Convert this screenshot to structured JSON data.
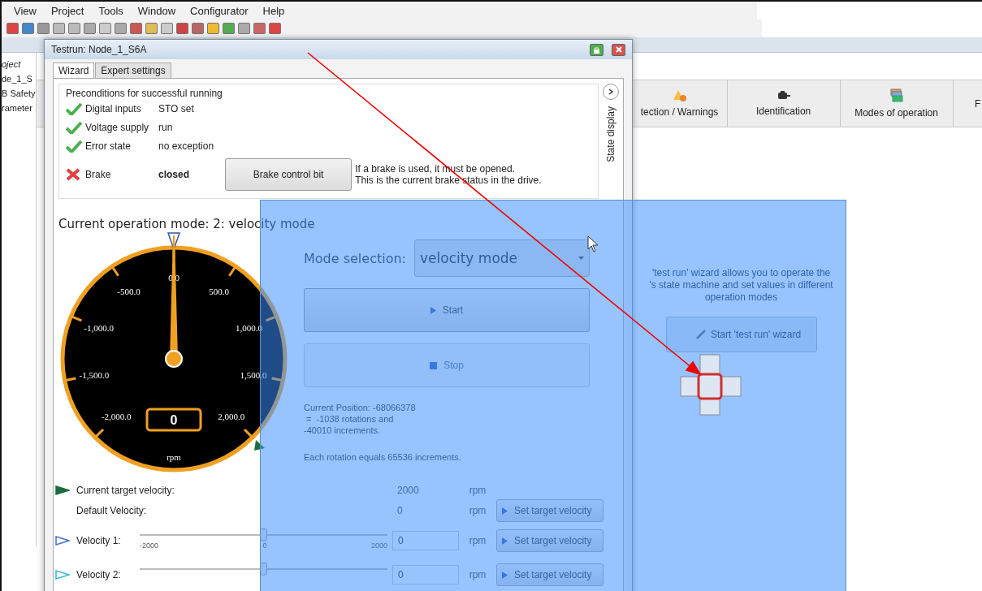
{
  "menu": [
    "View",
    "Project",
    "Tools",
    "Window",
    "Configurator",
    "Help"
  ],
  "project_panel": {
    "title": "oject",
    "items": [
      "de_1_S",
      "B Safety",
      "rameter"
    ]
  },
  "ribbon": [
    {
      "label": "tection / Warnings",
      "kind": "warning"
    },
    {
      "label": "Identification",
      "kind": "motor"
    },
    {
      "label": "Modes of operation",
      "kind": "modes"
    },
    {
      "label": "F",
      "kind": "plain"
    }
  ],
  "start_panel": {
    "lines": [
      "'test run' wizard allows you to operate the",
      "'s state machine and set values in different",
      "operation modes"
    ],
    "button": "Start 'test run' wizard"
  },
  "dialog": {
    "title": "Testrun: Node_1_S6A",
    "tabs": [
      {
        "label": "Wizard",
        "selected": true
      },
      {
        "label": "Expert settings",
        "selected": false
      }
    ],
    "preconditions": {
      "title": "Preconditions for successful running",
      "rows": [
        {
          "label": "Digital inputs",
          "value": "STO set",
          "ok": true
        },
        {
          "label": "Voltage supply",
          "value": "run",
          "ok": true
        },
        {
          "label": "Error state",
          "value": "no exception",
          "ok": true
        },
        {
          "label": "Brake",
          "value": "closed",
          "ok": false
        }
      ],
      "brake_button": "Brake control bit",
      "note": "If a brake is used, it must be opened.\nThis is the current brake status in the drive."
    },
    "side_label": "State display",
    "mode_heading": "Current operation mode: 2: velocity mode",
    "gauge": {
      "labels": [
        "0.0",
        "-500.0",
        "500.0",
        "-1,000.0",
        "1,000.0",
        "-1,500.0",
        "1,500.0",
        "-2,000.0",
        "2,000.0"
      ],
      "value": "0",
      "unit": "rpm",
      "level": 0.5
    },
    "mode_selection": {
      "label": "Mode selection:",
      "value": "velocity mode"
    },
    "buttons": [
      {
        "label": "Start",
        "kind": "start",
        "disabled": false
      },
      {
        "label": "Stop",
        "kind": "stop",
        "disabled": true
      }
    ],
    "position_text": "Current Position: -68066378\n =  -1038 rotations and\n-40010 increments.",
    "rotation_text": "Each rotation equals 65536 increments.",
    "velocities": [
      {
        "kind": "readout",
        "label": "Current target velocity:",
        "value": "2000",
        "unit": "rpm",
        "color": "#1b6e3c"
      },
      {
        "kind": "readout",
        "label": "Default Velocity:",
        "value": "0",
        "unit": "rpm",
        "button": "Set target velocity"
      },
      {
        "kind": "slider",
        "label": "Velocity 1:",
        "value": "0",
        "unit": "rpm",
        "button": "Set target velocity",
        "color": "#4a6fd0",
        "level": 0.5,
        "scale": [
          "-2000",
          "0",
          "2000"
        ]
      },
      {
        "kind": "slider",
        "label": "Velocity 2:",
        "value": "0",
        "unit": "rpm",
        "button": "Set target velocity",
        "color": "#36b8dc",
        "level": 0.5
      }
    ]
  }
}
